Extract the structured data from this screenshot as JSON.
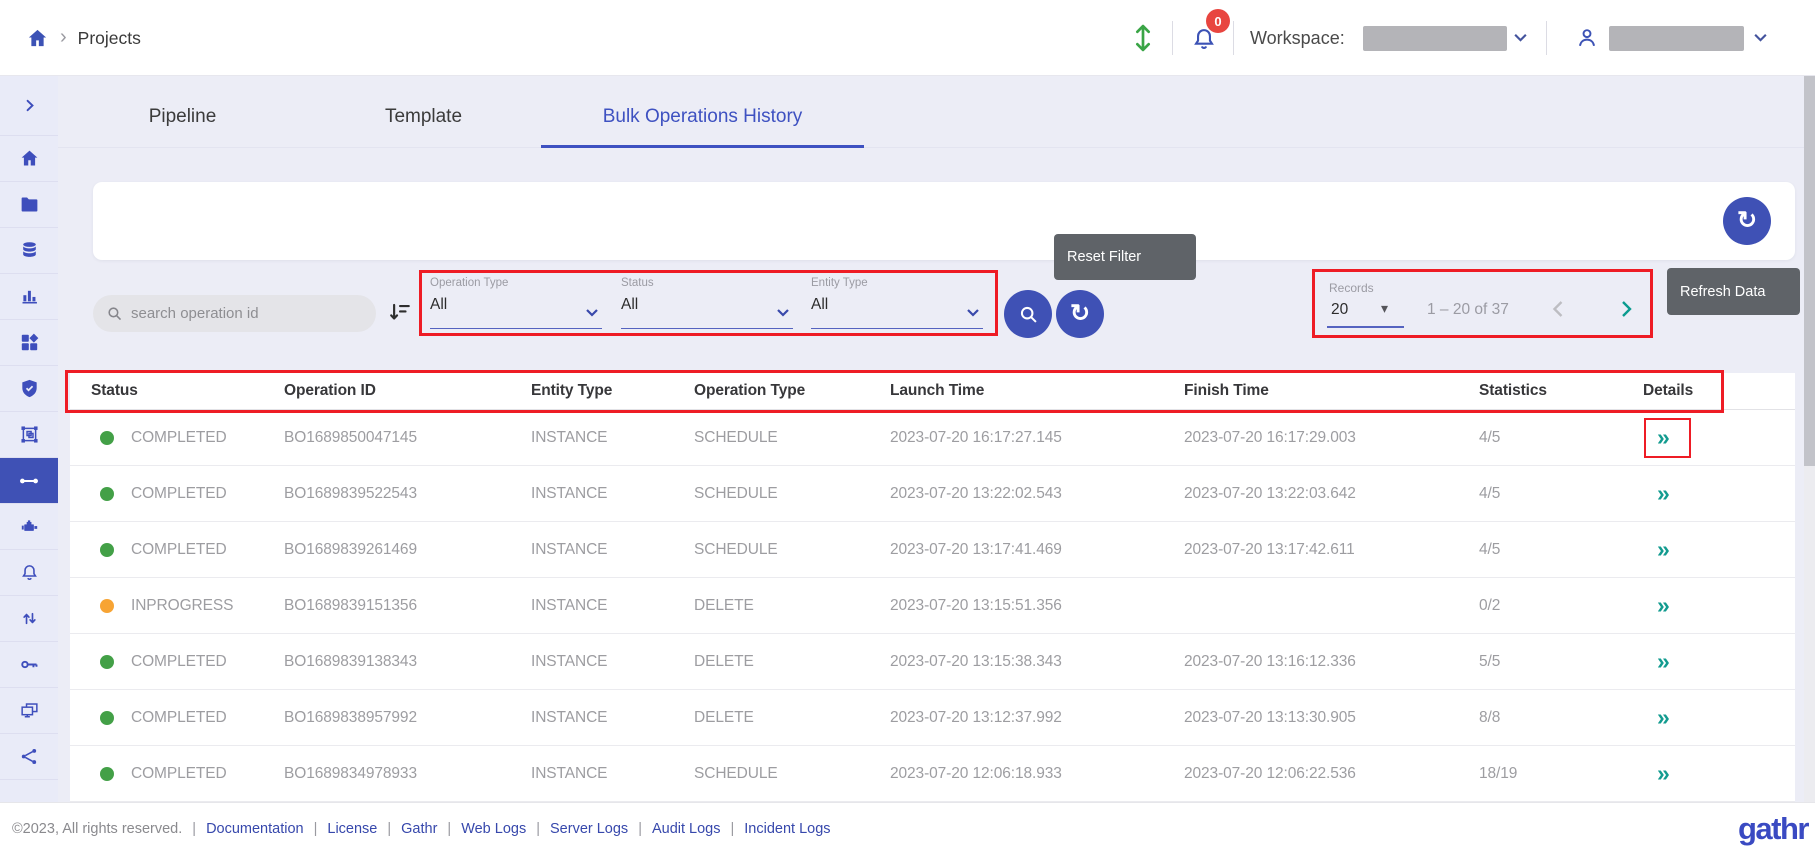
{
  "colors": {
    "primary": "#3f51b5",
    "active_tab": "#3e51c1",
    "teal_accent": "#129b8f",
    "status_green": "#43a047",
    "status_orange": "#f7a434",
    "annotation_red": "#ee1c25",
    "tooltip_bg": "#5f6368",
    "badge_red": "#e8453f",
    "brand_blue": "#3a4ac2"
  },
  "icons": {
    "breadcrumb_separator": "›",
    "refresh_glyph": "↻",
    "details_glyph": "»",
    "records_caret": "▾"
  },
  "header": {
    "breadcrumb": "Projects",
    "notification_badge": "0",
    "workspace_label": "Workspace:"
  },
  "sidebar": {
    "icons": [
      "chevron-right",
      "home",
      "folder",
      "database",
      "bar-chart",
      "components",
      "shield-check",
      "frame-box",
      "pipeline-link",
      "engine",
      "bell",
      "up-down-arrows",
      "key",
      "monitors",
      "share"
    ],
    "active_icon": "pipeline-link"
  },
  "tabs": {
    "items": [
      {
        "label": "Pipeline",
        "active": false
      },
      {
        "label": "Template",
        "active": false
      },
      {
        "label": "Bulk Operations History",
        "active": true
      }
    ]
  },
  "toolbar": {
    "search_placeholder": "search operation id",
    "filters": [
      {
        "label": "Operation Type",
        "value": "All"
      },
      {
        "label": "Status",
        "value": "All"
      },
      {
        "label": "Entity Type",
        "value": "All"
      }
    ],
    "reset_tooltip": "Reset Filter",
    "refresh_tooltip": "Refresh Data",
    "records_label": "Records",
    "records_value": "20",
    "range_text": "1 – 20 of 37"
  },
  "table": {
    "columns": [
      "Status",
      "Operation ID",
      "Entity Type",
      "Operation Type",
      "Launch Time",
      "Finish Time",
      "Statistics",
      "Details"
    ],
    "rows": [
      {
        "status": "COMPLETED",
        "status_color": "green",
        "operation_id": "BO1689850047145",
        "entity_type": "INSTANCE",
        "operation_type": "SCHEDULE",
        "launch_time": "2023-07-20 16:17:27.145",
        "finish_time": "2023-07-20 16:17:29.003",
        "statistics": "4/5"
      },
      {
        "status": "COMPLETED",
        "status_color": "green",
        "operation_id": "BO1689839522543",
        "entity_type": "INSTANCE",
        "operation_type": "SCHEDULE",
        "launch_time": "2023-07-20 13:22:02.543",
        "finish_time": "2023-07-20 13:22:03.642",
        "statistics": "4/5"
      },
      {
        "status": "COMPLETED",
        "status_color": "green",
        "operation_id": "BO1689839261469",
        "entity_type": "INSTANCE",
        "operation_type": "SCHEDULE",
        "launch_time": "2023-07-20 13:17:41.469",
        "finish_time": "2023-07-20 13:17:42.611",
        "statistics": "4/5"
      },
      {
        "status": "INPROGRESS",
        "status_color": "orange",
        "operation_id": "BO1689839151356",
        "entity_type": "INSTANCE",
        "operation_type": "DELETE",
        "launch_time": "2023-07-20 13:15:51.356",
        "finish_time": "",
        "statistics": "0/2"
      },
      {
        "status": "COMPLETED",
        "status_color": "green",
        "operation_id": "BO1689839138343",
        "entity_type": "INSTANCE",
        "operation_type": "DELETE",
        "launch_time": "2023-07-20 13:15:38.343",
        "finish_time": "2023-07-20 13:16:12.336",
        "statistics": "5/5"
      },
      {
        "status": "COMPLETED",
        "status_color": "green",
        "operation_id": "BO1689838957992",
        "entity_type": "INSTANCE",
        "operation_type": "DELETE",
        "launch_time": "2023-07-20 13:12:37.992",
        "finish_time": "2023-07-20 13:13:30.905",
        "statistics": "8/8"
      },
      {
        "status": "COMPLETED",
        "status_color": "green",
        "operation_id": "BO1689834978933",
        "entity_type": "INSTANCE",
        "operation_type": "SCHEDULE",
        "launch_time": "2023-07-20 12:06:18.933",
        "finish_time": "2023-07-20 12:06:22.536",
        "statistics": "18/19"
      }
    ]
  },
  "footer": {
    "copyright": "©2023, All rights reserved.",
    "links": [
      "Documentation",
      "License",
      "Gathr",
      "Web Logs",
      "Server Logs",
      "Audit Logs",
      "Incident Logs"
    ],
    "brand": "gathr"
  }
}
